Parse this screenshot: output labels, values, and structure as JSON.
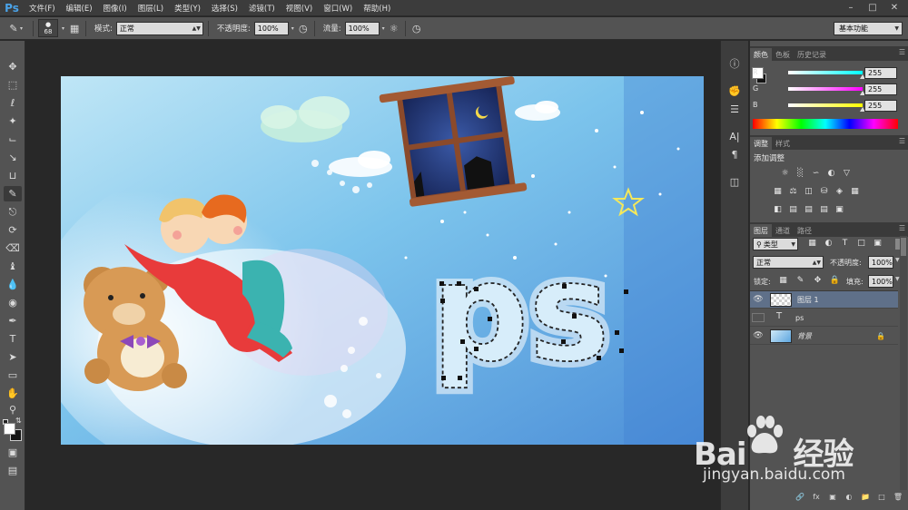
{
  "app": {
    "logo": "Ps"
  },
  "menu": [
    "文件(F)",
    "编辑(E)",
    "图像(I)",
    "图层(L)",
    "类型(Y)",
    "选择(S)",
    "滤镜(T)",
    "视图(V)",
    "窗口(W)",
    "帮助(H)"
  ],
  "options_bar": {
    "brush_size": "68",
    "mode_label": "模式:",
    "mode_value": "正常",
    "opacity_label": "不透明度:",
    "opacity_value": "100%",
    "flow_label": "流量:",
    "flow_value": "100%",
    "workspace": "基本功能"
  },
  "icon_strip": [
    "info-icon",
    "brush-presets-icon",
    "adjust-sliders-icon",
    "character-icon",
    "paragraph-icon",
    "layer-comps-icon"
  ],
  "color_panel": {
    "tabs": [
      "颜色",
      "色板",
      "历史记录"
    ],
    "channels": [
      {
        "label": "R",
        "value": "255",
        "gradient_end": "#00ffff",
        "level": 1.0
      },
      {
        "label": "G",
        "value": "255",
        "gradient_end": "#ff00ff",
        "level": 1.0
      },
      {
        "label": "B",
        "value": "255",
        "gradient_end": "#ffff00",
        "level": 1.0
      }
    ]
  },
  "adjustments_panel": {
    "tabs": [
      "调整",
      "样式"
    ],
    "title": "添加调整"
  },
  "layers_panel": {
    "tabs": [
      "图层",
      "通道",
      "路径"
    ],
    "filter_label": "类型",
    "blend_mode": "正常",
    "opacity_label": "不透明度:",
    "opacity_value": "100%",
    "lock_label": "锁定:",
    "fill_label": "填充:",
    "fill_value": "100%",
    "layers": [
      {
        "name": "图层 1",
        "type": "pixel",
        "visible": true,
        "selected": true
      },
      {
        "name": "ps",
        "type": "text",
        "visible": false,
        "selected": false
      },
      {
        "name": "背景",
        "type": "background",
        "visible": true,
        "selected": false,
        "locked": true
      }
    ]
  },
  "artwork": {
    "text": "ps"
  },
  "watermark": {
    "brand_a": "Bai",
    "brand_b": "经验",
    "url": "jingyan.baidu.com"
  }
}
